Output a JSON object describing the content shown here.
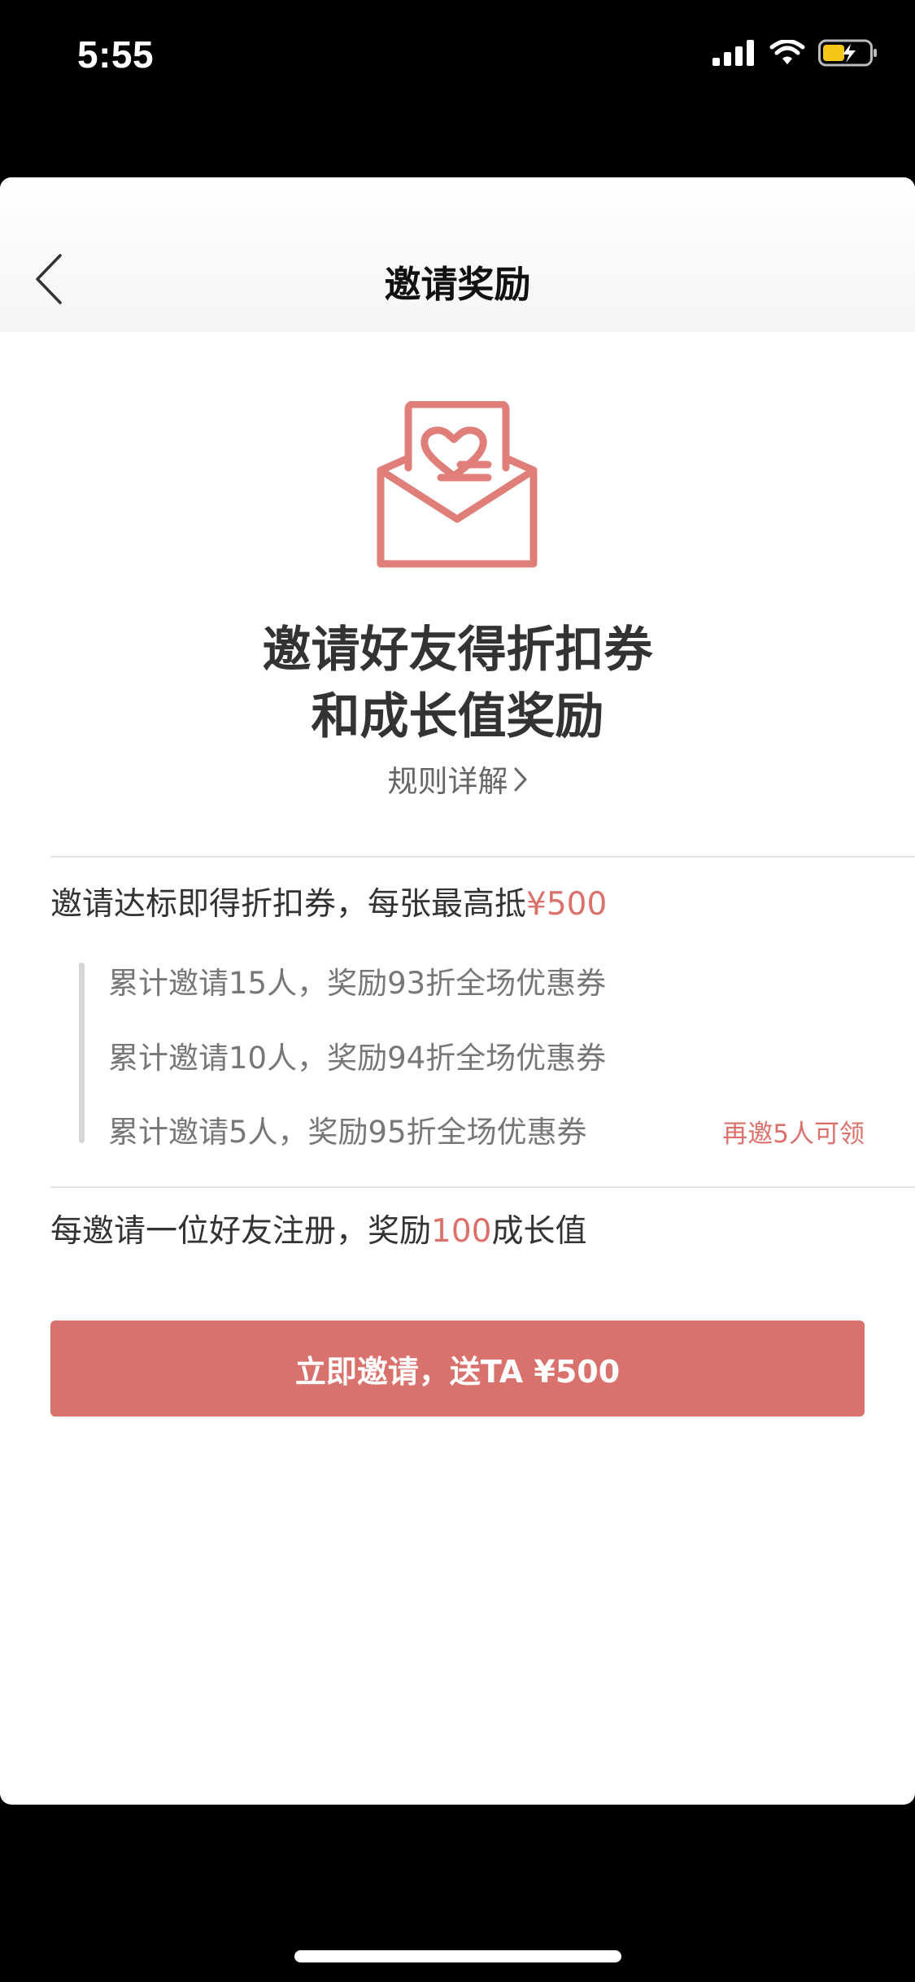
{
  "status_bar": {
    "time": "5:55"
  },
  "nav": {
    "title": "邀请奖励",
    "back_icon": "chevron-left-icon"
  },
  "hero": {
    "icon": "envelope-heart-icon",
    "headline_line1": "邀请好友得折扣券",
    "headline_line2": "和成长值奖励",
    "rules_link": "规则详解"
  },
  "coupon_section": {
    "title_prefix": "邀请达标即得折扣券，每张最高抵",
    "title_amount": "¥500",
    "tiers": [
      {
        "pre": "累计邀请15人，奖励",
        "discount": "93",
        "post": "折全场优惠券",
        "hint": ""
      },
      {
        "pre": "累计邀请10人，奖励",
        "discount": "94",
        "post": "折全场优惠券",
        "hint": ""
      },
      {
        "pre": "累计邀请5人，奖励",
        "discount": "95",
        "post": "折全场优惠券",
        "hint": "再邀5人可领"
      }
    ]
  },
  "growth_section": {
    "prefix": "每邀请一位好友注册，奖励",
    "amount": "100",
    "suffix": "成长值"
  },
  "cta": {
    "label": "立即邀请，送TA ¥500"
  },
  "colors": {
    "accent": "#dc716c",
    "button": "#d9716c",
    "icon": "#e07f7a"
  }
}
